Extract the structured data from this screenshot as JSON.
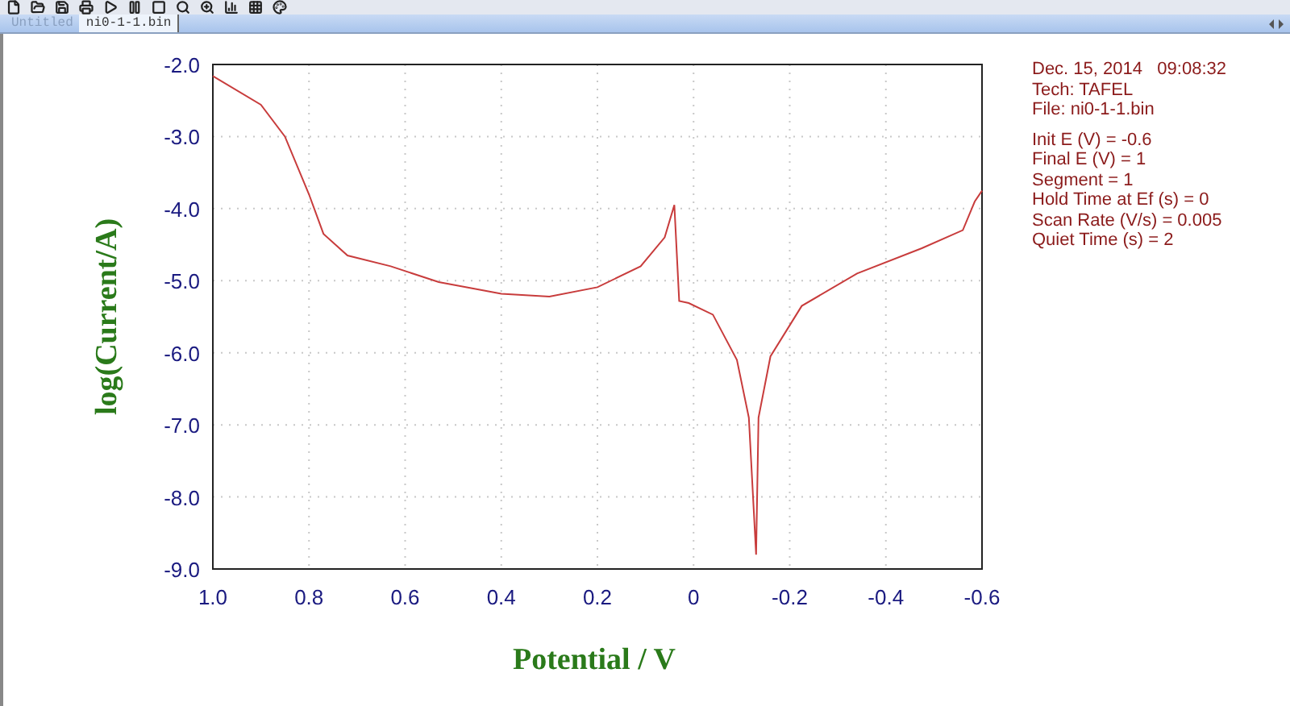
{
  "tabs": [
    {
      "label": "Untitled",
      "selected": false
    },
    {
      "label": "ni0-1-1.bin",
      "selected": true
    }
  ],
  "plot": {
    "chart_data": {
      "type": "line",
      "grid": true,
      "xlabel": "Potential / V",
      "ylabel": "log(Current/A)",
      "xlim": [
        1.0,
        -0.6
      ],
      "ylim": [
        -9,
        -2
      ],
      "xticks": [
        {
          "value": 1.0,
          "label": "1.0"
        },
        {
          "value": 0.8,
          "label": "0.8"
        },
        {
          "value": 0.6,
          "label": "0.6"
        },
        {
          "value": 0.4,
          "label": "0.4"
        },
        {
          "value": 0.2,
          "label": "0.2"
        },
        {
          "value": 0,
          "label": "0"
        },
        {
          "value": -0.2,
          "label": "-0.2"
        },
        {
          "value": -0.4,
          "label": "-0.4"
        },
        {
          "value": -0.6,
          "label": "-0.6"
        }
      ],
      "yticks": [
        {
          "value": -2,
          "label": "-2.0"
        },
        {
          "value": -3,
          "label": "-3.0"
        },
        {
          "value": -4,
          "label": "-4.0"
        },
        {
          "value": -5,
          "label": "-5.0"
        },
        {
          "value": -6,
          "label": "-6.0"
        },
        {
          "value": -7,
          "label": "-7.0"
        },
        {
          "value": -8,
          "label": "-8.0"
        },
        {
          "value": -9,
          "label": "-9.0"
        }
      ],
      "x": [
        1.0,
        0.9,
        0.85,
        0.8,
        0.77,
        0.72,
        0.63,
        0.53,
        0.4,
        0.3,
        0.2,
        0.11,
        0.06,
        0.04,
        0.03,
        0.01,
        -0.04,
        -0.09,
        -0.115,
        -0.13,
        -0.135,
        -0.16,
        -0.225,
        -0.34,
        -0.475,
        -0.56,
        -0.585,
        -0.6
      ],
      "series": [
        {
          "color": "#c83c3c",
          "values": [
            -2.16,
            -2.56,
            -3.0,
            -3.8,
            -4.35,
            -4.65,
            -4.8,
            -5.02,
            -5.18,
            -5.22,
            -5.09,
            -4.8,
            -4.4,
            -3.95,
            -5.28,
            -5.31,
            -5.47,
            -6.1,
            -6.9,
            -8.8,
            -6.9,
            -6.05,
            -5.35,
            -4.9,
            -4.55,
            -4.3,
            -3.9,
            -3.75
          ]
        }
      ]
    }
  },
  "info": {
    "header": [
      "Dec. 15, 2014   09:08:32",
      "Tech: TAFEL",
      "File: ni0-1-1.bin"
    ],
    "parameters": [
      "Init E (V) = -0.6",
      "Final E (V) = 1",
      "Segment = 1",
      "Hold Time at Ef (s) = 0",
      "Scan Rate (V/s) = 0.005",
      "Quiet Time (s) = 2"
    ]
  }
}
